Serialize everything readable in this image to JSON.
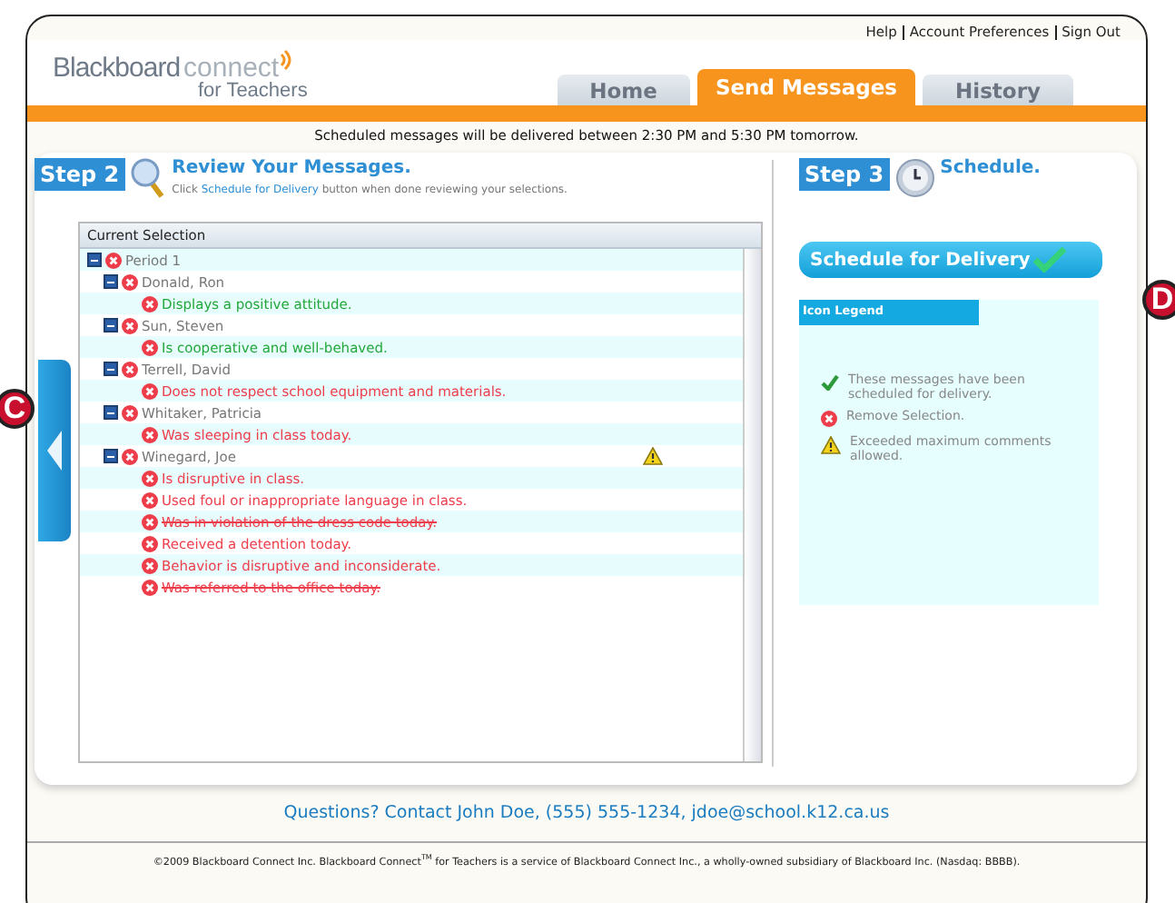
{
  "top_links": [
    "Help",
    "Account Preferences",
    "Sign Out"
  ],
  "logo": {
    "brand": "Blackboard",
    "product": "connect",
    "tagline": "for Teachers"
  },
  "tabs": [
    {
      "label": "Home",
      "selected": false
    },
    {
      "label": "Send Messages",
      "selected": true
    },
    {
      "label": "History",
      "selected": false
    }
  ],
  "notice": "Scheduled messages will be delivered between 2:30 PM and 5:30 PM tomorrow.",
  "step2": {
    "badge": "Step 2",
    "title": "Review Your Messages.",
    "hint": "Click **Schedule for Delivery** button when done reviewing your selections."
  },
  "tree": {
    "header": "Current Selection",
    "items": [
      {
        "label": "Period 1",
        "expanded": true,
        "children": [
          {
            "label": "Donald, Ron",
            "expanded": true,
            "warning": false,
            "children": [
              {
                "label": "Displays a positive attitude.",
                "color": "#22a83a",
                "struck": false
              }
            ]
          },
          {
            "label": "Sun, Steven",
            "expanded": true,
            "warning": false,
            "children": [
              {
                "label": "Is cooperative and well-behaved.",
                "color": "#22a83a",
                "struck": false
              }
            ]
          },
          {
            "label": "Terrell, David",
            "expanded": true,
            "warning": false,
            "children": [
              {
                "label": "Does not respect school equipment and materials.",
                "color": "#ee3d4a",
                "struck": false
              }
            ]
          },
          {
            "label": "Whitaker, Patricia",
            "expanded": true,
            "warning": false,
            "children": [
              {
                "label": "Was sleeping in class today.",
                "color": "#ee3d4a",
                "struck": false
              }
            ]
          },
          {
            "label": "Winegard, Joe",
            "expanded": true,
            "warning": true,
            "children": [
              {
                "label": "Is disruptive in class.",
                "color": "#ee3d4a",
                "struck": false
              },
              {
                "label": "Used foul or inappropriate language in class.",
                "color": "#ee3d4a",
                "struck": false
              },
              {
                "label": "Was in violation of the dress code today.",
                "color": "#ee3d4a",
                "struck": true
              },
              {
                "label": "Received a detention today.",
                "color": "#ee3d4a",
                "struck": false
              },
              {
                "label": "Behavior is disruptive and inconsiderate.",
                "color": "#ee3d4a",
                "struck": false
              },
              {
                "label": "Was referred to the office today.",
                "color": "#ee3d4a",
                "struck": true
              }
            ]
          }
        ]
      }
    ]
  },
  "step3": {
    "badge": "Step 3",
    "title": "Schedule.",
    "button": "Schedule for Delivery"
  },
  "legend": {
    "title": "Icon Legend",
    "items": [
      {
        "kind": "check",
        "text": "These messages have been scheduled for delivery."
      },
      {
        "kind": "remove",
        "text": "Remove Selection."
      },
      {
        "kind": "warning",
        "text": "Exceeded maximum comments allowed."
      }
    ]
  },
  "callouts": [
    "C",
    "D"
  ],
  "contact": "Questions? Contact John Doe, (555) 555-1234, jdoe@school.k12.ca.us",
  "copyright": "©2009 Blackboard Connect Inc. Blackboard Connect$^{TM}$ for Teachers is a service of Blackboard Connect Inc., a wholly-owned subsidiary of Blackboard Inc. (Nasdaq: BBBB)."
}
